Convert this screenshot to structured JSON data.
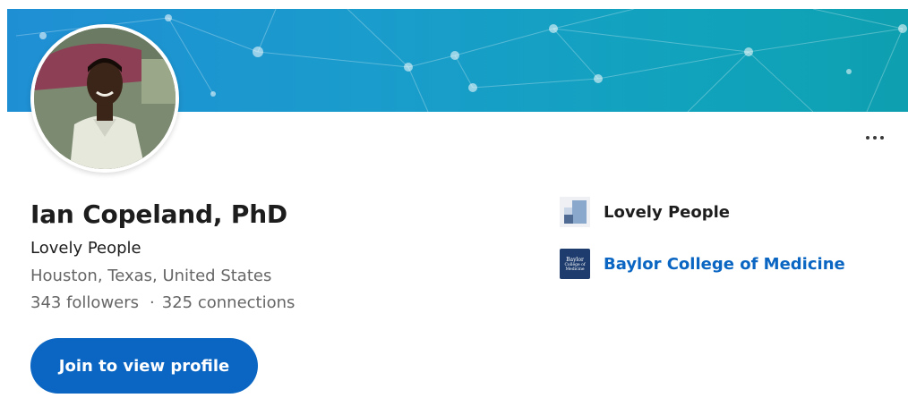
{
  "colors": {
    "banner_start": "#1f8fd4",
    "banner_end": "#0ea0b0",
    "primary_button": "#0a66c2",
    "link": "#0a66c2",
    "text_primary": "#1d1d1d",
    "text_secondary": "#666666"
  },
  "header": {
    "more_icon": "ellipsis-horizontal-icon"
  },
  "profile": {
    "name": "Ian Copeland, PhD",
    "headline": "Lovely People",
    "location": "Houston, Texas, United States",
    "followers": "343 followers",
    "separator": "·",
    "connections": "325 connections",
    "join_button_label": "Join to view profile"
  },
  "experience": {
    "items": [
      {
        "label": "Lovely People",
        "logo": "lovely-people-logo"
      },
      {
        "label": "Baylor College of Medicine",
        "logo": "baylor-college-of-medicine-logo",
        "logo_text": [
          "Baylor",
          "College of",
          "Medicine"
        ]
      }
    ]
  }
}
